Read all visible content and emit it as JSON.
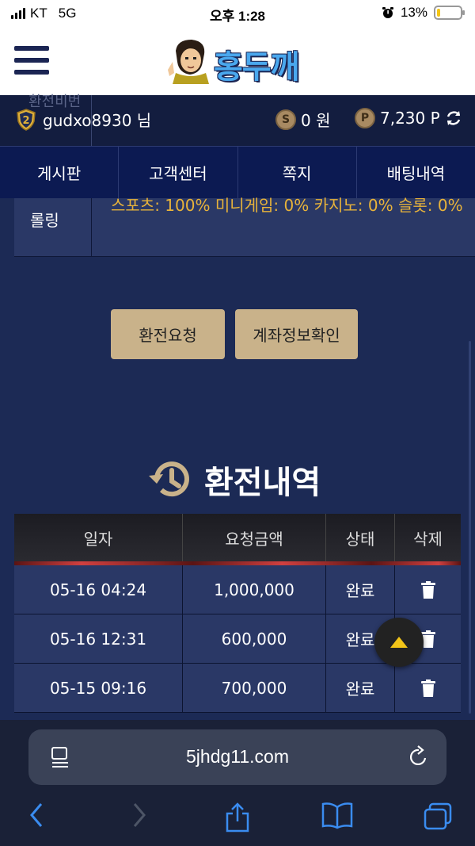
{
  "status_bar": {
    "carrier": "KT",
    "network": "5G",
    "time": "오후 1:28",
    "battery": "13%",
    "battery_level": 0.13
  },
  "header": {
    "logo_text": "홍두깨"
  },
  "user": {
    "ghost_label": "환전비번",
    "name": "gudxo8930 님",
    "money": "0 원",
    "points": "7,230 P",
    "level": "2",
    "coin_money": "S",
    "coin_points": "P"
  },
  "nav": {
    "tabs": [
      "게시판",
      "고객센터",
      "쪽지",
      "배팅내역"
    ]
  },
  "rolling": {
    "label": "롤링",
    "value": "스포츠: 100%   미니게임: 0%   카지노: 0%   슬롯: 0%"
  },
  "buttons": {
    "request": "환전요청",
    "account": "계좌정보확인"
  },
  "history": {
    "title": "환전내역",
    "columns": [
      "일자",
      "요청금액",
      "상태",
      "삭제"
    ],
    "rows": [
      {
        "date": "05-16 04:24",
        "amount": "1,000,000",
        "status": "완료"
      },
      {
        "date": "05-16 12:31",
        "amount": "600,000",
        "status": "완료"
      },
      {
        "date": "05-15 09:16",
        "amount": "700,000",
        "status": "완료"
      }
    ]
  },
  "browser": {
    "url": "5jhdg11.com"
  },
  "colors": {
    "accent_gold": "#c9b28a",
    "nav_bg": "#0c1a52",
    "page_bg": "#1c2a55",
    "rolling_text": "#e8b33a"
  }
}
